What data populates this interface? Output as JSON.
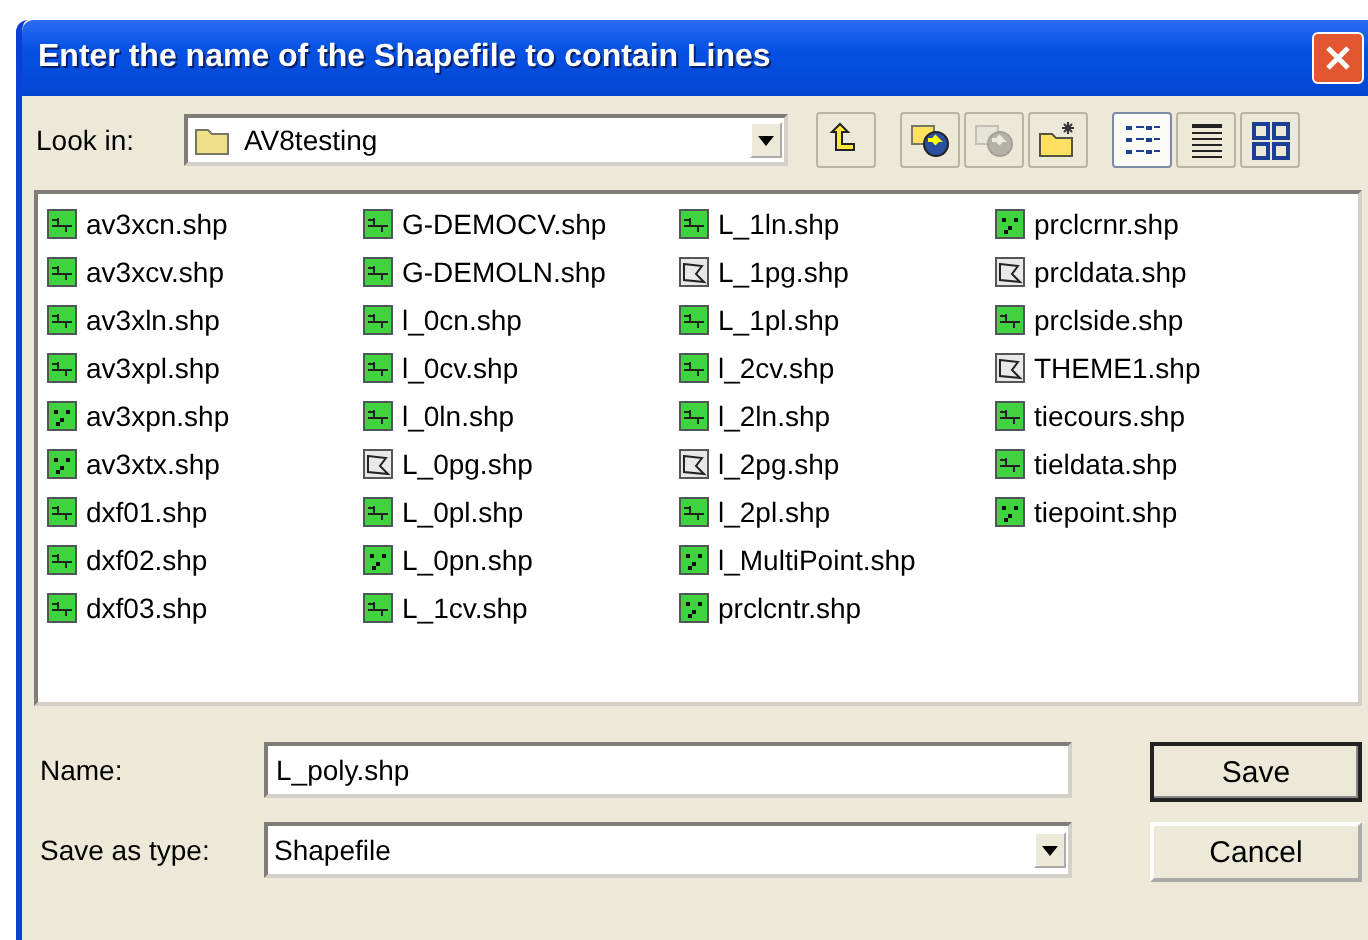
{
  "window": {
    "title": "Enter the name of the Shapefile to contain Lines"
  },
  "look_in": {
    "label": "Look in:",
    "value": "AV8testing"
  },
  "toolbar": [
    {
      "kind": "up",
      "disabled": false
    },
    {
      "kind": "web",
      "disabled": false
    },
    {
      "kind": "web",
      "disabled": true
    },
    {
      "kind": "newfolder",
      "disabled": false
    }
  ],
  "views": [
    {
      "kind": "list",
      "selected": true
    },
    {
      "kind": "details",
      "selected": false
    },
    {
      "kind": "icons",
      "selected": false
    }
  ],
  "files": [
    {
      "name": "av3xcn.shp",
      "kind": "line"
    },
    {
      "name": "av3xcv.shp",
      "kind": "line"
    },
    {
      "name": "av3xln.shp",
      "kind": "line"
    },
    {
      "name": "av3xpl.shp",
      "kind": "line"
    },
    {
      "name": "av3xpn.shp",
      "kind": "point"
    },
    {
      "name": "av3xtx.shp",
      "kind": "point"
    },
    {
      "name": "dxf01.shp",
      "kind": "line"
    },
    {
      "name": "dxf02.shp",
      "kind": "line"
    },
    {
      "name": "dxf03.shp",
      "kind": "line"
    },
    {
      "name": "G-DEMOCV.shp",
      "kind": "line"
    },
    {
      "name": "G-DEMOLN.shp",
      "kind": "line"
    },
    {
      "name": "l_0cn.shp",
      "kind": "line"
    },
    {
      "name": "l_0cv.shp",
      "kind": "line"
    },
    {
      "name": "l_0ln.shp",
      "kind": "line"
    },
    {
      "name": "L_0pg.shp",
      "kind": "polygon"
    },
    {
      "name": "L_0pl.shp",
      "kind": "line"
    },
    {
      "name": "L_0pn.shp",
      "kind": "point"
    },
    {
      "name": "L_1cv.shp",
      "kind": "line"
    },
    {
      "name": "L_1ln.shp",
      "kind": "line"
    },
    {
      "name": "L_1pg.shp",
      "kind": "polygon"
    },
    {
      "name": "L_1pl.shp",
      "kind": "line"
    },
    {
      "name": "l_2cv.shp",
      "kind": "line"
    },
    {
      "name": "l_2ln.shp",
      "kind": "line"
    },
    {
      "name": "l_2pg.shp",
      "kind": "polygon"
    },
    {
      "name": "l_2pl.shp",
      "kind": "line"
    },
    {
      "name": "l_MultiPoint.shp",
      "kind": "point"
    },
    {
      "name": "prclcntr.shp",
      "kind": "point"
    },
    {
      "name": "prclcrnr.shp",
      "kind": "point"
    },
    {
      "name": "prcldata.shp",
      "kind": "polygon"
    },
    {
      "name": "prclside.shp",
      "kind": "line"
    },
    {
      "name": "THEME1.shp",
      "kind": "polygon"
    },
    {
      "name": "tiecours.shp",
      "kind": "line"
    },
    {
      "name": "tieldata.shp",
      "kind": "line"
    },
    {
      "name": "tiepoint.shp",
      "kind": "point"
    }
  ],
  "name_field": {
    "label": "Name:",
    "value": "L_poly.shp"
  },
  "type_field": {
    "label": "Save as type:",
    "value": "Shapefile"
  },
  "buttons": [
    "Save",
    "Cancel"
  ]
}
